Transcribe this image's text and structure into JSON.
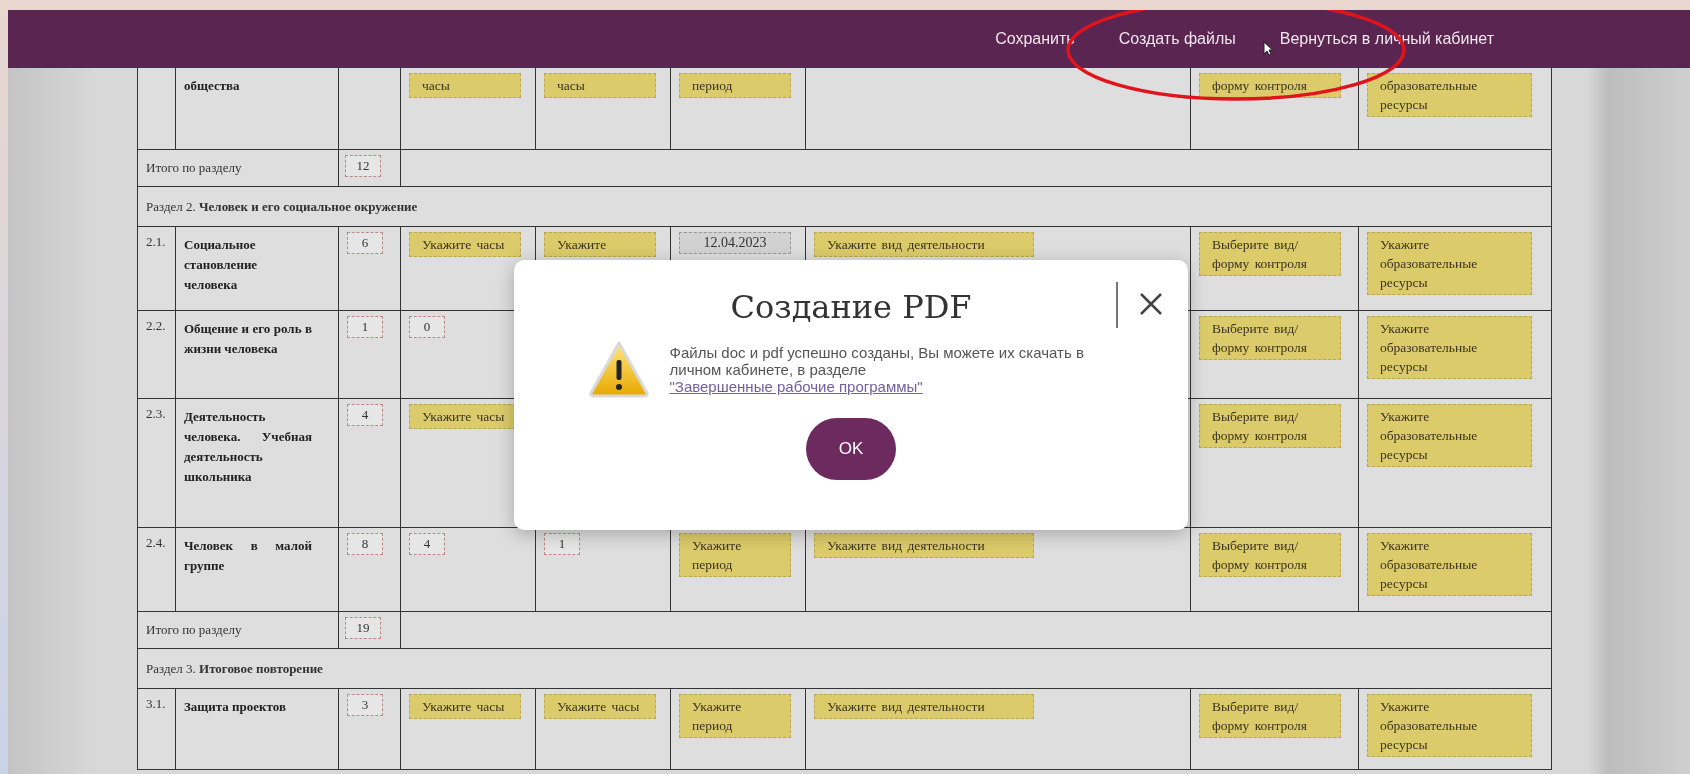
{
  "header": {
    "links": [
      {
        "label": "Сохранить"
      },
      {
        "label": "Создать файлы"
      },
      {
        "label": "Вернуться в личный кабинет"
      }
    ]
  },
  "table": {
    "rows": [
      {
        "kind": "topic",
        "name": "общества",
        "cells": [
          {
            "kind": "blank"
          },
          {
            "kind": "chip",
            "text": "часы"
          },
          {
            "kind": "chip",
            "text": "часы"
          },
          {
            "kind": "chip",
            "text": "период"
          },
          {
            "kind": "blank"
          },
          {
            "kind": "chip",
            "text": "форму контроля"
          },
          {
            "kind": "chip",
            "text": "образовательные ресурсы"
          }
        ]
      },
      {
        "kind": "total",
        "label": "Итого по разделу",
        "value": "12"
      },
      {
        "kind": "section",
        "title": "Раздел 2. **Человек и его социальное окружение**"
      },
      {
        "kind": "topic",
        "number": "2.1.",
        "name": "Социальное становление человека",
        "cells": [
          {
            "kind": "number",
            "text": "6"
          },
          {
            "kind": "chip",
            "text": "Укажите часы"
          },
          {
            "kind": "chip",
            "text": "Укажите"
          },
          {
            "kind": "date",
            "text": "12.04.2023"
          },
          {
            "kind": "chip",
            "text": "Укажите вид деятельности"
          },
          {
            "kind": "chip",
            "text": "Выберите вид/ форму контроля"
          },
          {
            "kind": "chip",
            "text": "Укажите образовательные ресурсы"
          }
        ]
      },
      {
        "kind": "topic",
        "number": "2.2.",
        "name": "Общение и его роль в жизни человека",
        "cells": [
          {
            "kind": "number",
            "text": "1"
          },
          {
            "kind": "number",
            "text": "0"
          },
          {
            "kind": "blank"
          },
          {
            "kind": "blank"
          },
          {
            "kind": "blank"
          },
          {
            "kind": "chip",
            "text": "Выберите вид/ форму контроля"
          },
          {
            "kind": "chip",
            "text": "Укажите образовательные ресурсы"
          }
        ]
      },
      {
        "kind": "topic",
        "number": "2.3.",
        "name": "Деятельность человека. Учебная деятельность школьника",
        "cells": [
          {
            "kind": "number",
            "text": "4"
          },
          {
            "kind": "chip",
            "text": "Укажите часы"
          },
          {
            "kind": "blank"
          },
          {
            "kind": "blank"
          },
          {
            "kind": "blank"
          },
          {
            "kind": "chip",
            "text": "Выберите вид/ форму контроля"
          },
          {
            "kind": "chip",
            "text": "Укажите образовательные ресурсы"
          }
        ]
      },
      {
        "kind": "topic",
        "number": "2.4.",
        "name": "Человек в малой группе",
        "cells": [
          {
            "kind": "number",
            "text": "8"
          },
          {
            "kind": "number",
            "text": "4"
          },
          {
            "kind": "number",
            "text": "1"
          },
          {
            "kind": "chip",
            "text": "Укажите период"
          },
          {
            "kind": "chip",
            "text": "Укажите вид деятельности"
          },
          {
            "kind": "chip",
            "text": "Выберите вид/ форму контроля"
          },
          {
            "kind": "chip",
            "text": "Укажите образовательные ресурсы"
          }
        ]
      },
      {
        "kind": "total",
        "label": "Итого по разделу",
        "value": "19"
      },
      {
        "kind": "section",
        "title": "Раздел 3. **Итоговое повторение**"
      },
      {
        "kind": "topic",
        "number": "3.1.",
        "name": "Защита проектов",
        "cells": [
          {
            "kind": "number",
            "text": "3"
          },
          {
            "kind": "chip",
            "text": "Укажите часы"
          },
          {
            "kind": "chip",
            "text": "Укажите часы"
          },
          {
            "kind": "chip",
            "text": "Укажите период"
          },
          {
            "kind": "chip",
            "text": "Укажите вид деятельности"
          },
          {
            "kind": "chip",
            "text": "Выберите вид/ форму контроля"
          },
          {
            "kind": "chip",
            "text": "Укажите образовательные ресурсы"
          }
        ]
      }
    ]
  },
  "modal": {
    "title": "Создание PDF",
    "message": "Файлы doc и pdf успешно созданы, Вы можете их скачать в личном кабинете, в разделе",
    "link": "\"Завершенные рабочие программы\"",
    "button": "OK"
  }
}
